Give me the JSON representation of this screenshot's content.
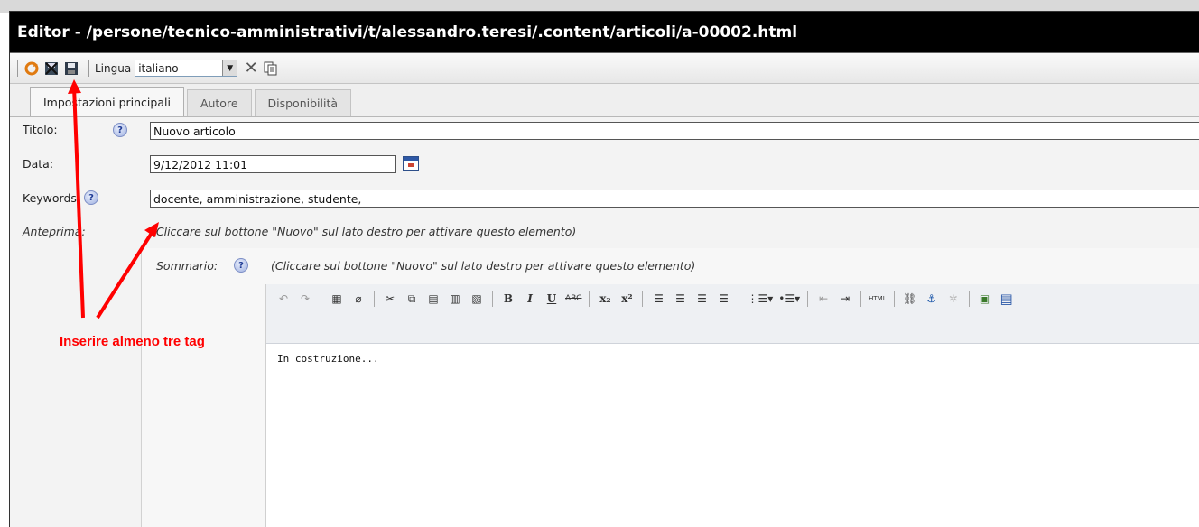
{
  "window": {
    "title": "Editor - /persone/tecnico-amministrativi/t/alessandro.teresi/.content/articoli/a-00002.html"
  },
  "toolbar": {
    "icons": [
      "refresh-icon",
      "close-save-icon",
      "save-icon"
    ],
    "language_label": "Lingua",
    "language_value": "italiano"
  },
  "tabs": [
    {
      "label": "Impostazioni principali",
      "active": true
    },
    {
      "label": "Autore",
      "active": false
    },
    {
      "label": "Disponibilità",
      "active": false
    }
  ],
  "form": {
    "title_label": "Titolo:",
    "title_value": "Nuovo articolo",
    "date_label": "Data:",
    "date_value": "9/12/2012 11:01",
    "keywords_label": "Keywords:",
    "keywords_value": "docente, amministrazione, studente,",
    "preview_label": "Anteprima:",
    "preview_hint": "(Cliccare sul bottone \"Nuovo\" sul lato destro per attivare questo elemento)",
    "summary_label": "Sommario:",
    "summary_hint": "(Cliccare sul bottone \"Nuovo\" sul lato destro per attivare questo elemento)",
    "help_glyph": "?"
  },
  "richtext": {
    "content": "In costruzione..."
  },
  "annotation": {
    "text": "Inserire almeno tre tag",
    "color": "#ff0000"
  }
}
